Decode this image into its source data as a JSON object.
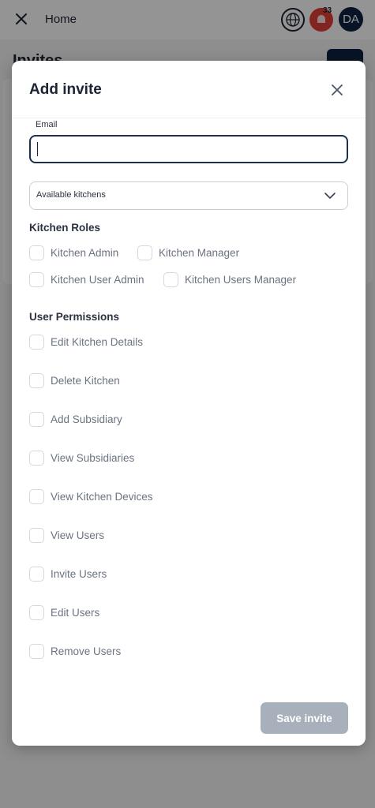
{
  "topbar": {
    "home_label": "Home",
    "notification_count": "33",
    "avatar_initials": "DA"
  },
  "background": {
    "page_title": "Invites"
  },
  "modal": {
    "title": "Add invite",
    "email": {
      "label": "Email",
      "value": "",
      "placeholder": ""
    },
    "kitchens_select": {
      "selected": "Available kitchens"
    },
    "kitchen_roles": {
      "title": "Kitchen Roles",
      "items": [
        {
          "label": "Kitchen Admin",
          "checked": false
        },
        {
          "label": "Kitchen Manager",
          "checked": false
        },
        {
          "label": "Kitchen User Admin",
          "checked": false
        },
        {
          "label": "Kitchen Users Manager",
          "checked": false
        }
      ]
    },
    "user_permissions": {
      "title": "User Permissions",
      "items": [
        {
          "label": "Edit Kitchen Details",
          "checked": false
        },
        {
          "label": "Delete Kitchen",
          "checked": false
        },
        {
          "label": "Add Subsidiary",
          "checked": false
        },
        {
          "label": "View Subsidiaries",
          "checked": false
        },
        {
          "label": "View Kitchen Devices",
          "checked": false
        },
        {
          "label": "View Users",
          "checked": false
        },
        {
          "label": "Invite Users",
          "checked": false
        },
        {
          "label": "Edit Users",
          "checked": false
        },
        {
          "label": "Remove Users",
          "checked": false
        }
      ]
    },
    "save_label": "Save invite"
  },
  "colors": {
    "primary_dark": "#0f2140",
    "notification_red": "#e0403a",
    "save_disabled": "#a7b0bb",
    "checkbox_border": "#d4d8de"
  },
  "icons": {
    "close": "close-icon",
    "globe": "globe-icon",
    "bell": "bell-icon",
    "chevron": "chevron-down-icon"
  }
}
